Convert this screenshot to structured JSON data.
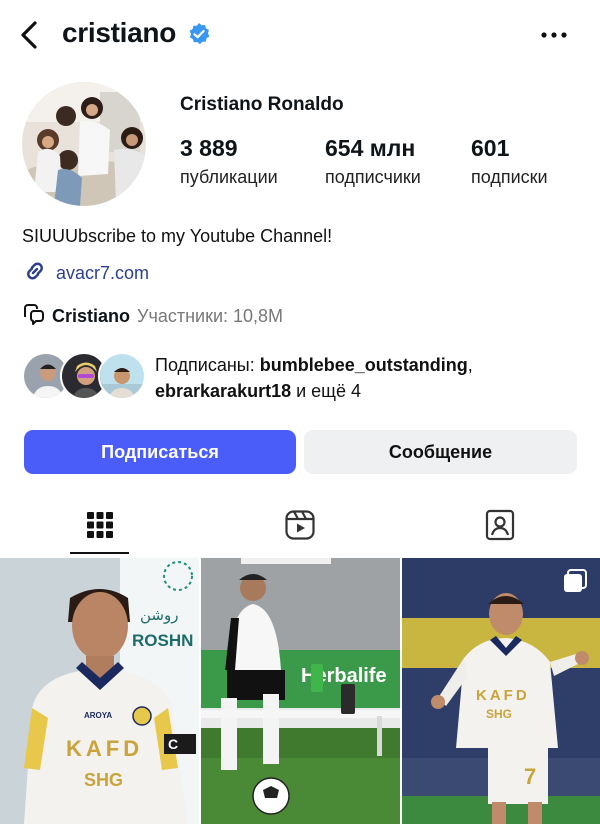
{
  "header": {
    "username": "cristiano",
    "back_icon": "chevron-left-icon",
    "verified_icon": "verified-badge-icon",
    "more_icon": "more-dots-icon"
  },
  "profile": {
    "full_name": "Cristiano Ronaldo",
    "stats": {
      "posts": {
        "value": "3 889",
        "label": "публикации"
      },
      "followers": {
        "value": "654 млн",
        "label": "подписчики"
      },
      "following": {
        "value": "601",
        "label": "подписки"
      }
    },
    "bio": "SIUUUbscribe to my Youtube Channel!",
    "link": "avacr7.com",
    "channel": {
      "name": "Cristiano",
      "members": "Участники: 10,8M"
    }
  },
  "mutuals": {
    "prefix": "Подписаны: ",
    "first": "bumblebee_outstanding",
    "sep": ",",
    "second": "ebrarkarakurt18",
    "suffix": " и ещё 4"
  },
  "actions": {
    "follow": "Подписаться",
    "message": "Сообщение"
  },
  "tabs": [
    {
      "name": "grid",
      "icon": "grid-icon",
      "active": true
    },
    {
      "name": "reels",
      "icon": "reels-icon",
      "active": false
    },
    {
      "name": "tagged",
      "icon": "tagged-user-icon",
      "active": false
    }
  ],
  "colors": {
    "accent": "#4a5df9",
    "verified": "#3897f0",
    "link": "#2c3e8f",
    "secondary_button": "#eff0f2"
  },
  "posts": {
    "tile1_text": "ROSHN",
    "tile1_logo_text": "روشن",
    "tile1_kit_text": "KAFD",
    "tile1_kit_sponsor": "SHG",
    "tile1_kit_brand": "AROYA",
    "tile2_text": "Herbalife",
    "tile3_kit_text": "KAFD",
    "tile3_kit_sponsor": "SHG"
  }
}
